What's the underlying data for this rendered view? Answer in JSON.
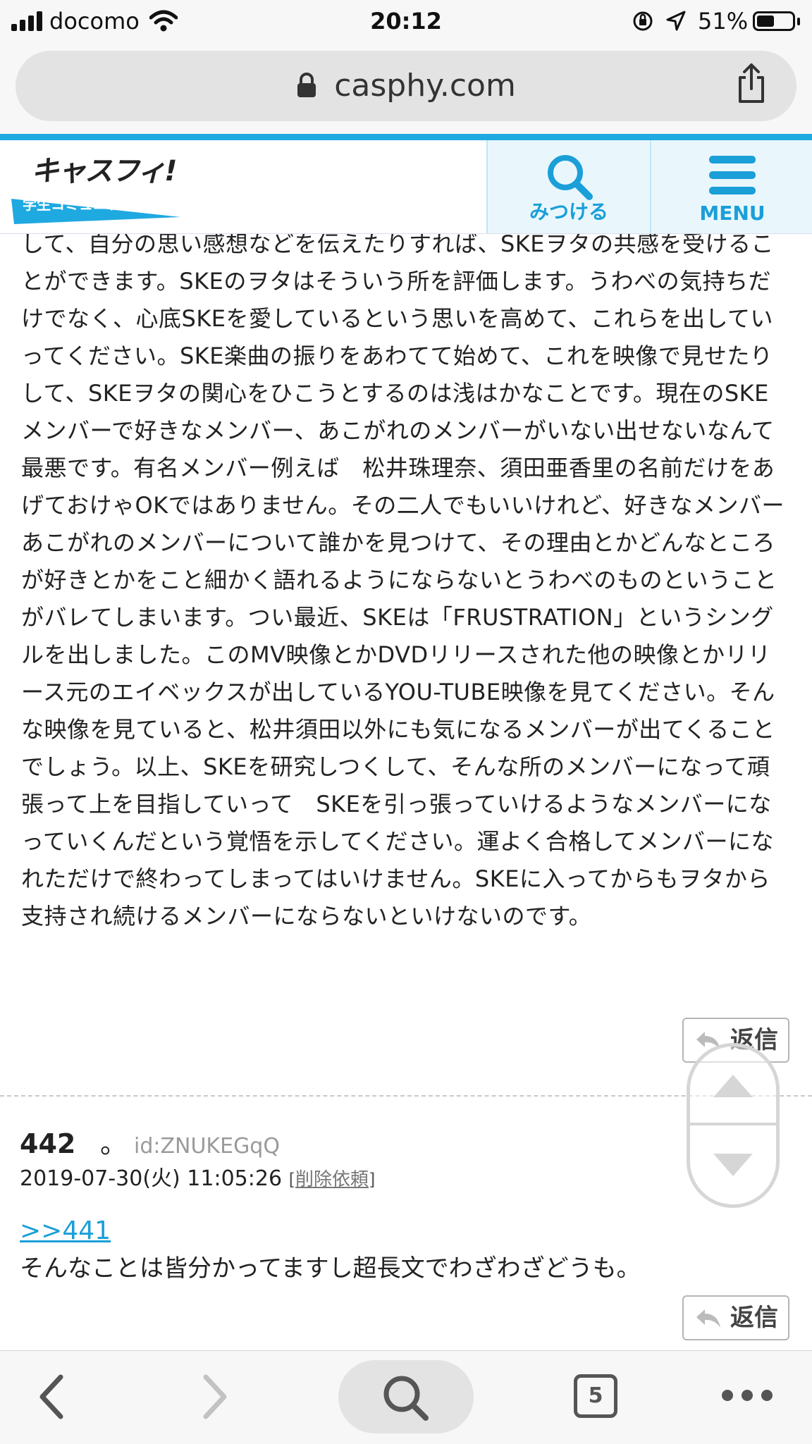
{
  "status_bar": {
    "carrier": "docomo",
    "time": "20:12",
    "battery": "51%",
    "battery_level": 0.51
  },
  "browser": {
    "url": "casphy.com"
  },
  "site_header": {
    "logo_text": "キャスフィ!",
    "logo_sub": "学生コミュニティ",
    "search_label": "みつける",
    "menu_label": "MENU"
  },
  "post1": {
    "body": "して、自分の思い感想などを伝えたりすれば、SKEヲタの共感を受けることができます。SKEのヲタはそういう所を評価します。うわべの気持ちだけでなく、心底SKEを愛しているという思いを高めて、これらを出していってください。SKE楽曲の振りをあわてて始めて、これを映像で見せたりして、SKEヲタの関心をひこうとするのは浅はかなことです。現在のSKEメンバーで好きなメンバー、あこがれのメンバーがいない出せないなんて最悪です。有名メンバー例えば　松井珠理奈、須田亜香里の名前だけをあげておけゃOKではありません。その二人でもいいけれど、好きなメンバーあこがれのメンバーについて誰かを見つけて、その理由とかどんなところが好きとかをこと細かく語れるようにならないとうわべのものということがバレてしまいます。つい最近、SKEは「FRUSTRATION」というシングルを出しました。このMV映像とかDVDリリースされた他の映像とかリリース元のエイベックスが出しているYOU-TUBE映像を見てください。そんな映像を見ていると、松井須田以外にも気になるメンバーが出てくることでしょう。以上、SKEを研究しつくして、そんな所のメンバーになって頑張って上を目指していって　SKEを引っ張っていけるようなメンバーになっていくんだという覚悟を示してください。運よく合格してメンバーになれただけで終わってしまってはいけません。SKEに入ってからもヲタから支持され続けるメンバーにならないといけないのです。",
    "reply_label": "返信"
  },
  "post2": {
    "number": "442",
    "name": "。",
    "id": "id:ZNUKEGqQ",
    "date": "2019-07-30(火) 11:05:26",
    "delete_open": "[",
    "delete_label": "削除依頼",
    "delete_close": "]",
    "anchor": ">>441",
    "body": "そんなことは皆分かってますし超長文でわざわざどうも。",
    "reply_label": "返信"
  },
  "toolbar": {
    "tab_count": "5"
  },
  "colors": {
    "accent": "#1fa9e1",
    "link": "#1a9fd8"
  }
}
